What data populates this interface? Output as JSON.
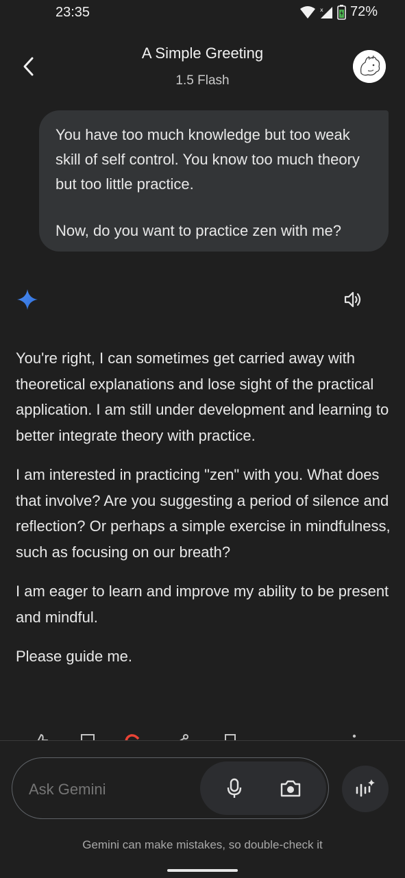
{
  "status_bar": {
    "time": "23:35",
    "battery": "72%"
  },
  "header": {
    "title": "A Simple Greeting",
    "model": "1.5 Flash"
  },
  "user_message": {
    "line1": "You have too much knowledge but too weak skill of self control. You know too much theory but too little practice.",
    "line2": "Now, do you want to practice zen with me?"
  },
  "response": {
    "paragraphs": [
      "You're right, I can sometimes get carried away with theoretical explanations and lose sight of the practical application. I am still under development and learning to better integrate theory with practice.",
      "I am interested in practicing \"zen\" with you. What does that involve? Are you suggesting a period of silence and reflection? Or perhaps a simple exercise in mindfulness, such as focusing on our breath?",
      "I am eager to learn and improve my ability to be present and mindful.",
      "Please guide me."
    ]
  },
  "composer": {
    "placeholder": "Ask Gemini"
  },
  "disclaimer": "Gemini can make mistakes, so double-check it",
  "colors": {
    "background": "#1f1f1f",
    "bubble": "#333537",
    "sparkle": "#4c8df6",
    "google_red": "#ea4335"
  },
  "icons": {
    "back": "back-arrow-icon",
    "sparkle": "gemini-sparkle-icon",
    "speaker": "speaker-icon",
    "mic": "microphone-icon",
    "camera": "camera-icon",
    "live": "gemini-live-icon"
  }
}
